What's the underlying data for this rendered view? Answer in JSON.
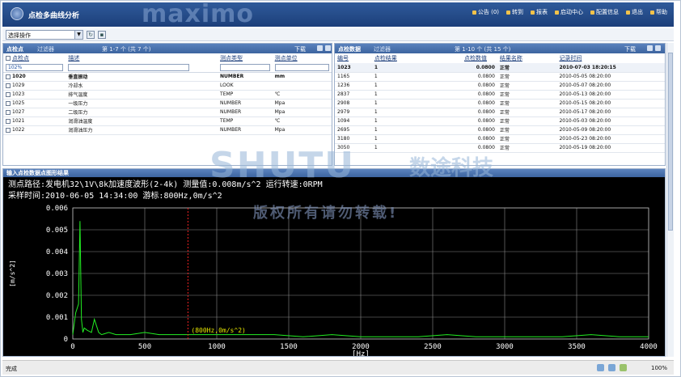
{
  "header": {
    "title": "点检多曲线分析",
    "brand": "maximo",
    "nav": [
      "公告 (0)",
      "转到",
      "报表",
      "启动中心",
      "配置信息",
      "退出",
      "帮助"
    ]
  },
  "actionbar": {
    "select_value": "选择操作"
  },
  "left_panel": {
    "title": "点检点",
    "filter": "过滤器",
    "pager": "第 1-7 个 (共 7 个)",
    "download": "下载",
    "columns": [
      "点检点",
      "描述",
      "测点类型",
      "测点单位"
    ],
    "filter_value": "102%",
    "rows": [
      [
        "1020",
        "垂直振动",
        "NUMBER",
        "mm"
      ],
      [
        "1029",
        "冷却水",
        "LOOK",
        ""
      ],
      [
        "1023",
        "排气温度",
        "TEMP",
        "℃"
      ],
      [
        "1025",
        "一级压力",
        "NUMBER",
        "Mpa"
      ],
      [
        "1027",
        "二级压力",
        "NUMBER",
        "Mpa"
      ],
      [
        "1021",
        "润滑油温度",
        "TEMP",
        "℃"
      ],
      [
        "1022",
        "润滑油压力",
        "NUMBER",
        "Mpa"
      ]
    ]
  },
  "right_panel": {
    "title": "点检数据",
    "filter": "过滤器",
    "pager": "第 1-10 个 (共 15 个)",
    "download": "下载",
    "columns": [
      "编号",
      "点检结果",
      "点检数值",
      "结果名称",
      "记录时间"
    ],
    "rows": [
      [
        "1023",
        "1",
        "0.0800",
        "正常",
        "2010-07-03 18:20:15"
      ],
      [
        "1165",
        "1",
        "0.0800",
        "正常",
        "2010-05-05 08:20:00"
      ],
      [
        "1236",
        "1",
        "0.0800",
        "正常",
        "2010-05-07 08:20:00"
      ],
      [
        "2837",
        "1",
        "0.0800",
        "正常",
        "2010-05-13 08:20:00"
      ],
      [
        "2908",
        "1",
        "0.0800",
        "正常",
        "2010-05-15 08:20:00"
      ],
      [
        "2979",
        "1",
        "0.0800",
        "正常",
        "2010-05-17 08:20:00"
      ],
      [
        "1094",
        "1",
        "0.0800",
        "正常",
        "2010-05-03 08:20:00"
      ],
      [
        "2695",
        "1",
        "0.0800",
        "正常",
        "2010-05-09 08:20:00"
      ],
      [
        "3180",
        "1",
        "0.0800",
        "正常",
        "2010-05-23 08:20:00"
      ],
      [
        "3050",
        "1",
        "0.0800",
        "正常",
        "2010-05-19 08:20:00"
      ]
    ]
  },
  "chart_panel": {
    "title": "输入点检数据点图形结果",
    "line1": "测点路径:发电机32\\1V\\8k加速度波形(2-4k)   测量值:0.008m/s^2   运行转速:0RPM",
    "line2": "采样时间:2010-06-05 14:34:00   游标:800Hz,0m/s^2",
    "cursor_label": "(800Hz,0m/s^2)",
    "ylabel": "[m/s^2]",
    "xlabel": "[Hz]"
  },
  "chart_data": {
    "type": "line",
    "xlabel": "[Hz]",
    "ylabel": "[m/s^2]",
    "xlim": [
      0,
      4000
    ],
    "ylim": [
      0,
      0.006
    ],
    "xticks": [
      "0",
      "500",
      "1000",
      "1500",
      "2000",
      "2500",
      "3000",
      "3500",
      "4000"
    ],
    "yticks": [
      "0",
      "0.001",
      "0.002",
      "0.003",
      "0.004",
      "0.005",
      "0.006"
    ],
    "cursor_x": 800,
    "x": [
      0,
      20,
      40,
      50,
      60,
      70,
      80,
      100,
      130,
      150,
      180,
      200,
      250,
      300,
      400,
      500,
      600,
      700,
      800,
      900,
      1000,
      1200,
      1400,
      1600,
      1800,
      2000,
      2200,
      2400,
      2600,
      2800,
      3000,
      3200,
      3400,
      3600,
      3800,
      4000
    ],
    "values": [
      0.0002,
      0.0012,
      0.0016,
      0.0054,
      0.0009,
      0.0003,
      0.0005,
      0.0004,
      0.0003,
      0.0009,
      0.0003,
      0.0002,
      0.0003,
      0.0002,
      0.0002,
      0.0003,
      0.0002,
      0.0002,
      0.0002,
      0.0002,
      0.0002,
      0.0002,
      0.0002,
      0.0001,
      0.0002,
      0.0001,
      0.0001,
      0.0001,
      0.0002,
      0.0001,
      0.0001,
      0.0001,
      0.0001,
      0.0002,
      0.0001,
      0.0001
    ],
    "grid": true,
    "line_color": "#22ee22",
    "cursor_color": "#ee2222"
  },
  "watermark": {
    "logo": "SHUTU",
    "cn": "数途科技",
    "copy": "版权所有请勿转载!"
  },
  "statusbar": {
    "text": "完成",
    "zoom": "100%"
  }
}
